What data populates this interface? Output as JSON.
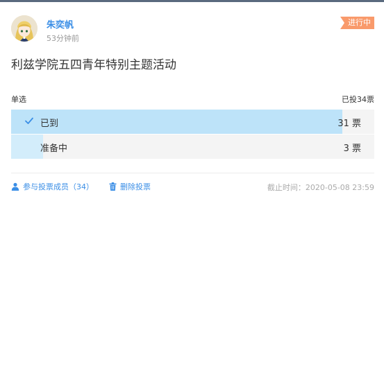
{
  "post": {
    "author": "朱奕帆",
    "time_ago": "53分钟前",
    "status": "进行中",
    "title": "利兹学院五四青年特别主题活动"
  },
  "poll": {
    "type_label": "单选",
    "total_label": "已投34票",
    "options": [
      {
        "label": "已到",
        "count_label": "31 票",
        "votes": 31,
        "selected": true
      },
      {
        "label": "准备中",
        "count_label": "3 票",
        "votes": 3,
        "selected": false
      }
    ],
    "total_votes": 34
  },
  "footer": {
    "members_label": "参与投票成员（34）",
    "delete_label": "删除投票",
    "deadline": "截止时间：2020-05-08 23:59"
  },
  "colors": {
    "accent": "#3a8ee6",
    "status_badge": "#f99a6b",
    "bar_selected": "#bde3f9",
    "bar_other": "#d3edfb"
  },
  "icons": {
    "avatar": "avatar-anime-icon",
    "check": "check-icon",
    "members": "user-icon",
    "delete": "trash-icon"
  }
}
